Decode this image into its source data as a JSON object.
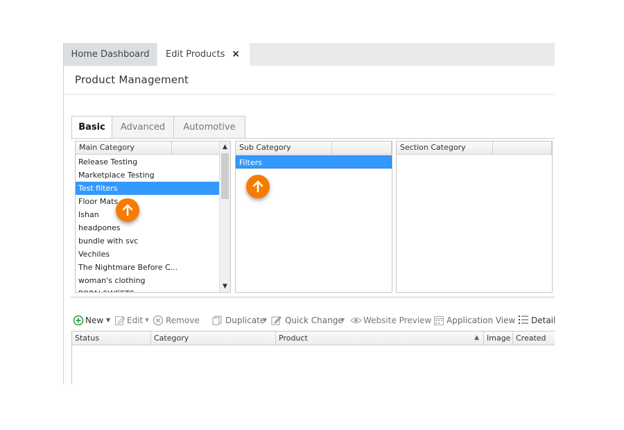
{
  "tabs": {
    "home": "Home Dashboard",
    "edit": "Edit Products",
    "close": "×"
  },
  "page_title": "Product Management",
  "inner_tabs": [
    "Basic",
    "Advanced",
    "Automotive"
  ],
  "main_category": {
    "header": "Main Category",
    "items": [
      "Release Testing",
      "Marketplace Testing",
      "Test filters",
      "Floor Mats",
      "Ishan",
      "headpones",
      "bundle with svc",
      "Vechiles",
      "The Nightmare Before C...",
      "woman's clothing",
      "POPAI SWEETS"
    ],
    "selected_index": 2
  },
  "sub_category": {
    "header": "Sub Category",
    "items": [
      "Filters"
    ],
    "selected_index": 0
  },
  "section_category": {
    "header": "Section Category",
    "items": []
  },
  "toolbar": {
    "new": "New",
    "edit": "Edit",
    "remove": "Remove",
    "duplicate": "Duplicate",
    "quick_change": "Quick Change",
    "website_preview": "Website Preview",
    "application_view": "Application View",
    "details": "Details"
  },
  "product_grid": {
    "columns": [
      "Status",
      "Category",
      "Product",
      "Image",
      "Created"
    ]
  },
  "colors": {
    "accent_orange": "#f57c00",
    "selection_blue": "#3399ff",
    "new_green": "#2e9e3e"
  }
}
